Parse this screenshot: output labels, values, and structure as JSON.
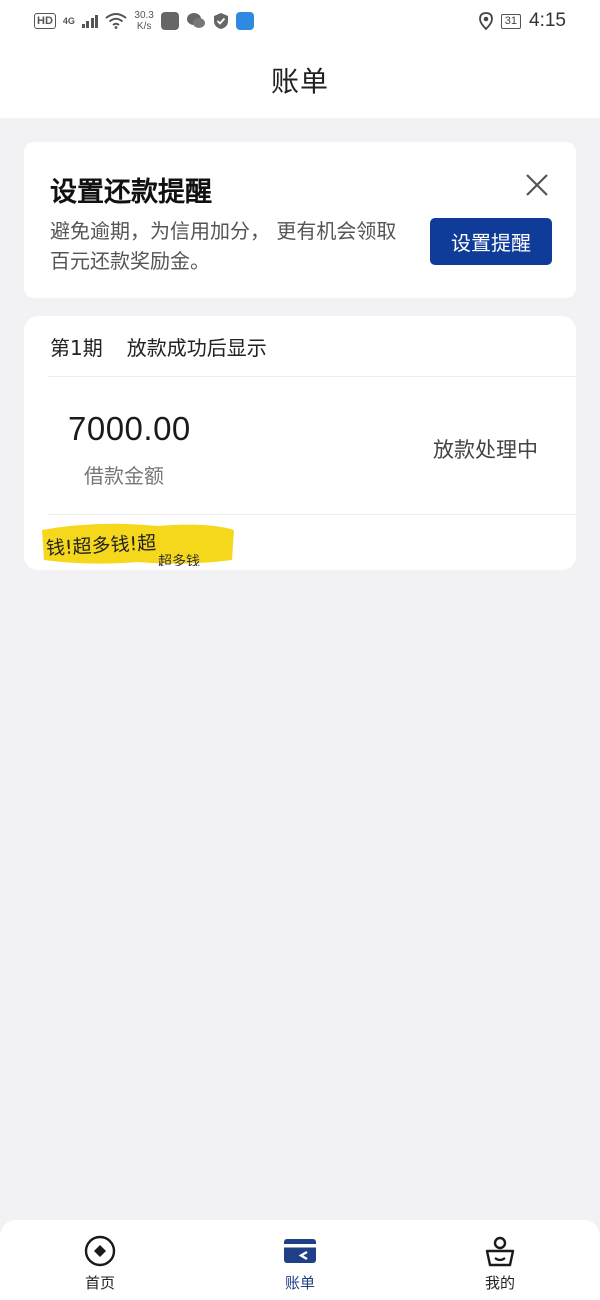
{
  "status_bar": {
    "hd": "HD",
    "network": "4G",
    "speed_value": "30.3",
    "speed_unit": "K/s",
    "battery": "31",
    "time": "4:15"
  },
  "header": {
    "title": "账单"
  },
  "reminder": {
    "title": "设置还款提醒",
    "description": "避免逾期，为信用加分， 更有机会领取百元还款奖励金。",
    "button_label": "设置提醒"
  },
  "bill": {
    "period": "第1期",
    "period_note": "放款成功后显示",
    "amount": "7000.00",
    "amount_label": "借款金额",
    "status": "放款处理中",
    "sticker_line1": "钱!超多钱!超",
    "sticker_line2": "超多钱"
  },
  "tabs": [
    {
      "label": "首页",
      "icon": "home-icon",
      "active": false
    },
    {
      "label": "账单",
      "icon": "bill-card-icon",
      "active": true
    },
    {
      "label": "我的",
      "icon": "profile-icon",
      "active": false
    }
  ],
  "colors": {
    "accent": "#0f3c99",
    "background": "#f2f2f4",
    "active_tab": "#1f3f87"
  }
}
